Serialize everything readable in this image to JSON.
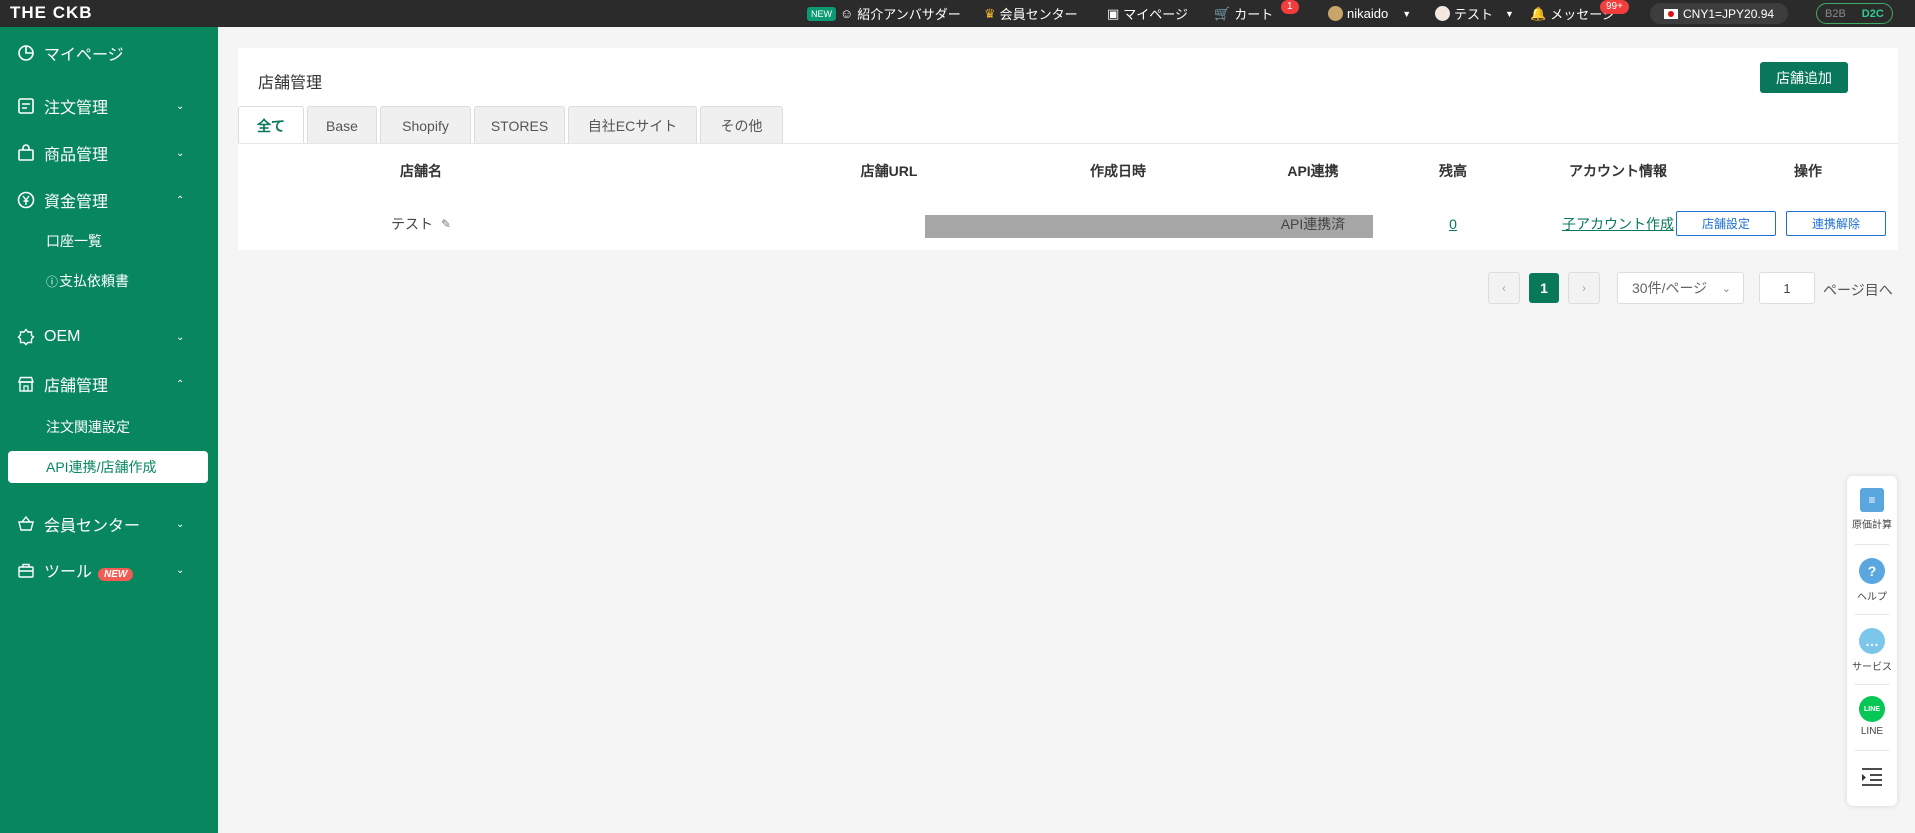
{
  "topbar": {
    "logo": "THE CKB",
    "new_pill": "NEW",
    "referral": "紹介アンバサダー",
    "member_center": "会員センター",
    "mypage": "マイページ",
    "cart": "カート",
    "cart_badge": "1",
    "user": "nikaido",
    "account": "テスト",
    "messages": "メッセージ",
    "messages_badge": "99+",
    "rate": "CNY1=JPY20.94",
    "mode_b2b": "B2B",
    "mode_d2c": "D2C"
  },
  "sidebar": {
    "mypage": "マイページ",
    "orders": "注文管理",
    "products": "商品管理",
    "funds": "資金管理",
    "funds_sub1": "口座一覧",
    "funds_sub2": "支払依頼書",
    "oem": "OEM",
    "stores": "店舗管理",
    "stores_sub1": "注文関連設定",
    "stores_sub2": "API連携/店舗作成",
    "member": "会員センター",
    "tools": "ツール",
    "tools_tag": "NEW"
  },
  "main": {
    "title": "店舗管理",
    "add_button": "店舗追加",
    "tabs": [
      "全て",
      "Base",
      "Shopify",
      "STORES",
      "自社ECサイト",
      "その他"
    ],
    "columns": [
      "店舗名",
      "店舗URL",
      "作成日時",
      "API連携",
      "残高",
      "アカウント情報",
      "操作"
    ],
    "row": {
      "name": "テスト",
      "api": "API連携済",
      "balance": "0",
      "account_link": "子アカウント作成",
      "btn_settings": "店舗設定",
      "btn_unlink": "連携解除"
    },
    "pagination": {
      "prev": "‹",
      "current": "1",
      "next": "›",
      "page_size": "30件/ページ",
      "goto_value": "1",
      "goto_suffix": "ページ目へ"
    }
  },
  "float_bar": {
    "cost": "原価計算",
    "help": "ヘルプ",
    "service": "サービス",
    "line": "LINE",
    "line_icon_text": "LINE"
  },
  "colors": {
    "brand": "#08875f",
    "accent_button": "#08775a",
    "link_blue": "#1d6fd6",
    "badge_red": "#f23d3d"
  }
}
